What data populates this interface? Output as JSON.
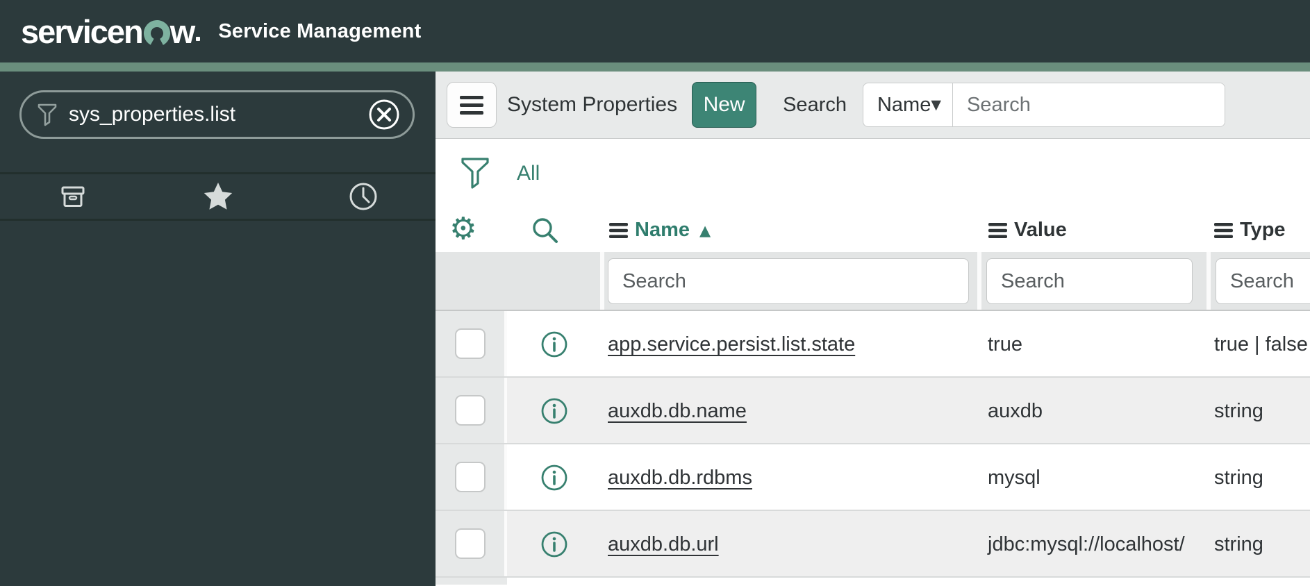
{
  "brand": {
    "logo_prefix": "servicen",
    "logo_suffix": "w",
    "logo_full": "servicenow",
    "product_name": "Service Management"
  },
  "sidebar": {
    "filter_input": {
      "value": "sys_properties.list"
    },
    "tabs": [
      {
        "icon": "archive-icon"
      },
      {
        "icon": "star-icon"
      },
      {
        "icon": "clock-icon"
      }
    ]
  },
  "list_header": {
    "title": "System Properties",
    "new_button_label": "New",
    "search_label": "Search",
    "search_field_selected": "Name",
    "select_caret": "▼",
    "search_input_placeholder": "Search"
  },
  "filter_bar": {
    "filter_label": "All"
  },
  "table": {
    "gear_glyph": "⚙",
    "column_search_placeholder": "Search",
    "columns": [
      {
        "label": "Name",
        "sorted": "ascending",
        "sort_arrow": "▲"
      },
      {
        "label": "Value",
        "sorted": ""
      },
      {
        "label": "Type",
        "sorted": ""
      }
    ],
    "rows": [
      {
        "name": "app.service.persist.list.state",
        "value": "true",
        "type": "true | false"
      },
      {
        "name": "auxdb.db.name",
        "value": "auxdb",
        "type": "string"
      },
      {
        "name": "auxdb.db.rdbms",
        "value": "mysql",
        "type": "string"
      },
      {
        "name": "auxdb.db.url",
        "value": "jdbc:mysql://localhost/",
        "type": "string"
      }
    ]
  },
  "colors": {
    "banner_bg": "#2c3a3c",
    "brand_strip_green": "#6a8e7d",
    "accent_green": "#37806f",
    "new_button_green": "#3d8575",
    "header_gray": "#e8eaea",
    "alt_row_gray": "#efefef",
    "text_dark": "#2f3436"
  }
}
